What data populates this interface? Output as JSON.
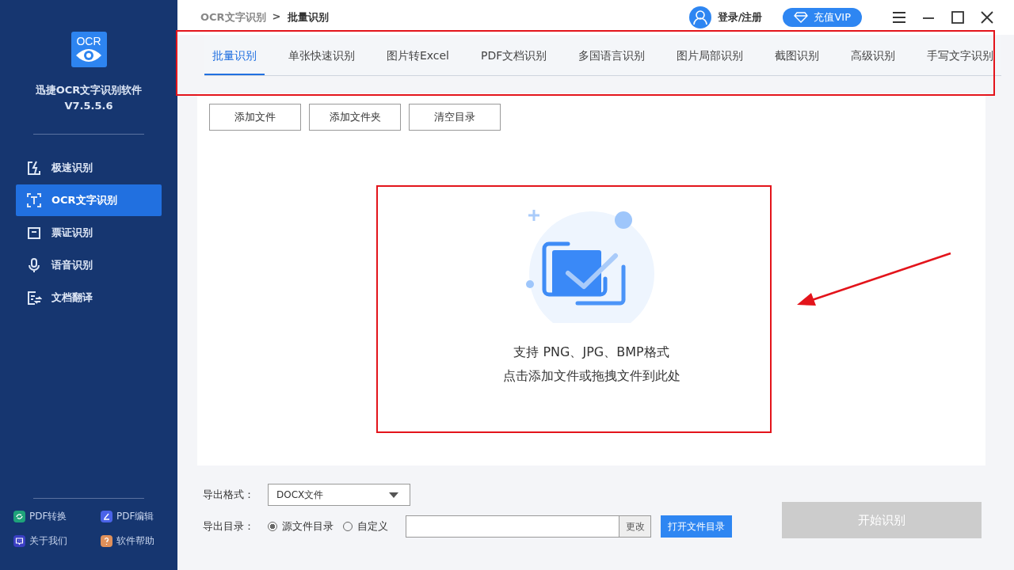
{
  "app": {
    "logo_text": "OCR",
    "name": "迅捷OCR文字识别软件",
    "version": "V7.5.5.6"
  },
  "nav": [
    {
      "label": "极速识别",
      "kind": "bolt",
      "selected": false
    },
    {
      "label": "OCR文字识别",
      "kind": "text",
      "selected": true
    },
    {
      "label": "票证识别",
      "kind": "card",
      "selected": false
    },
    {
      "label": "语音识别",
      "kind": "mic",
      "selected": false
    },
    {
      "label": "文档翻译",
      "kind": "translate",
      "selected": false
    }
  ],
  "footer_links": [
    {
      "label": "PDF转换",
      "kind": "convert",
      "color": "#1fa37a"
    },
    {
      "label": "PDF编辑",
      "kind": "edit",
      "color": "#4a63e8"
    },
    {
      "label": "关于我们",
      "kind": "chat",
      "color": "#3a3fc4"
    },
    {
      "label": "软件帮助",
      "kind": "help",
      "color": "#e0905a"
    }
  ],
  "breadcrumb": {
    "parent": "OCR文字识别",
    "separator": ">",
    "current": "批量识别"
  },
  "account": {
    "login": "登录/注册",
    "vip": "充值VIP"
  },
  "tabs": [
    {
      "label": "批量识别",
      "selected": true
    },
    {
      "label": "单张快速识别",
      "selected": false
    },
    {
      "label": "图片转Excel",
      "selected": false
    },
    {
      "label": "PDF文档识别",
      "selected": false
    },
    {
      "label": "多国语言识别",
      "selected": false
    },
    {
      "label": "图片局部识别",
      "selected": false
    },
    {
      "label": "截图识别",
      "selected": false
    },
    {
      "label": "高级识别",
      "selected": false
    },
    {
      "label": "手写文字识别",
      "selected": false
    }
  ],
  "toolbar": [
    "添加文件",
    "添加文件夹",
    "清空目录"
  ],
  "dropzone": {
    "lines": [
      "支持 PNG、JPG、BMP格式",
      "点击添加文件或拖拽文件到此处"
    ]
  },
  "export": {
    "format_label": "导出格式：",
    "format_value": "DOCX文件",
    "dir_label": "导出目录：",
    "options": [
      {
        "label": "源文件目录",
        "selected": true
      },
      {
        "label": "自定义",
        "selected": false
      }
    ],
    "change_button": "更改",
    "open_button": "打开文件目录"
  },
  "start_button": {
    "label": "开始识别",
    "disabled": true
  }
}
